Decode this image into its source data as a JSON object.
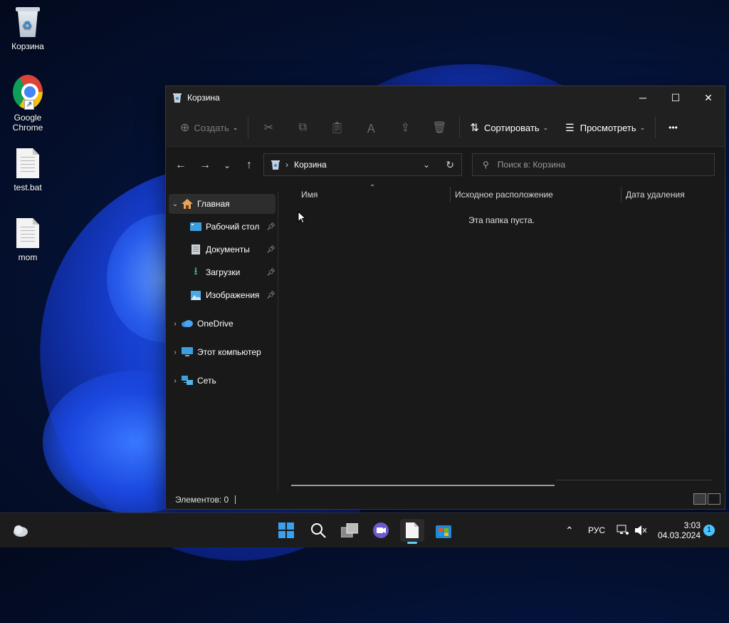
{
  "desktop": {
    "icons": [
      {
        "label": "Корзина"
      },
      {
        "label": "Google Chrome"
      },
      {
        "label": "test.bat"
      },
      {
        "label": "mom"
      }
    ]
  },
  "window": {
    "title": "Корзина",
    "controls": {
      "minimize": "─",
      "maximize": "☐",
      "close": "✕"
    }
  },
  "toolbar": {
    "create_label": "Создать",
    "sort_label": "Сортировать",
    "view_label": "Просмотреть",
    "more_label": "•••"
  },
  "address": {
    "location": "Корзина",
    "separator": "›"
  },
  "search": {
    "placeholder": "Поиск в: Корзина"
  },
  "sidebar": {
    "home": "Главная",
    "quick_access": [
      {
        "label": "Рабочий стол"
      },
      {
        "label": "Документы"
      },
      {
        "label": "Загрузки"
      },
      {
        "label": "Изображения"
      }
    ],
    "onedrive": "OneDrive",
    "this_pc": "Этот компьютер",
    "network": "Сеть"
  },
  "columns": {
    "name": "Имя",
    "original_location": "Исходное расположение",
    "date_deleted": "Дата удаления"
  },
  "main": {
    "empty_message": "Эта папка пуста."
  },
  "status": {
    "items_count": "Элементов: 0"
  },
  "taskbar": {
    "language": "РУС",
    "time": "3:03",
    "date": "04.03.2024",
    "notifications": "1"
  },
  "colors": {
    "accent": "#60cdff",
    "window_bg": "#191919",
    "chrome_bg": "#202020"
  }
}
